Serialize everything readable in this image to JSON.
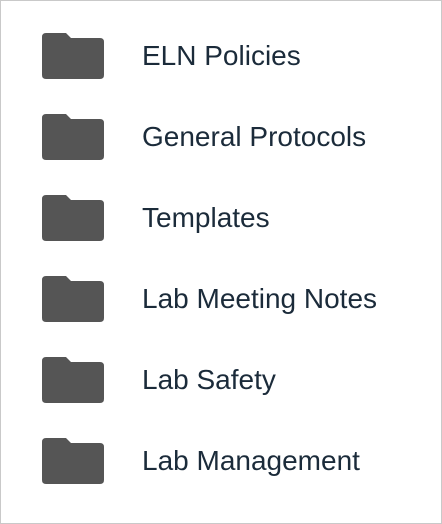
{
  "folders": {
    "icon": "folder-icon",
    "icon_color": "#555555",
    "text_color": "#1b2b3a",
    "items": [
      {
        "label": "ELN Policies"
      },
      {
        "label": "General Protocols"
      },
      {
        "label": "Templates"
      },
      {
        "label": "Lab Meeting Notes"
      },
      {
        "label": "Lab Safety"
      },
      {
        "label": "Lab Management"
      }
    ]
  }
}
